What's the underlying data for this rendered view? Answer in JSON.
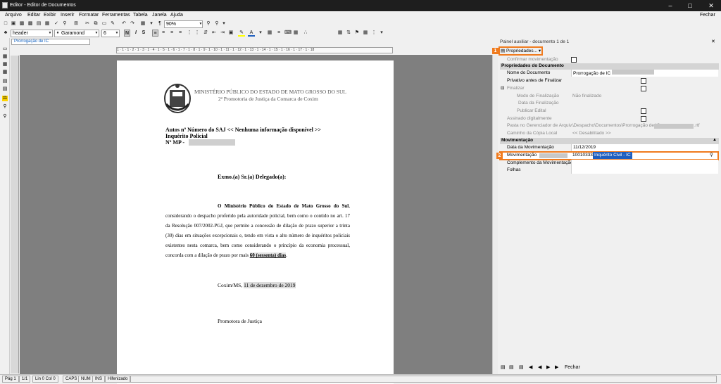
{
  "window": {
    "title": "Editor - Editor de Documentos",
    "close_label": "Fechar"
  },
  "menu": [
    "Arquivo",
    "Editar",
    "Exibir",
    "Inserir",
    "Formatar",
    "Ferramentas",
    "Tabela",
    "Janela",
    "Ajuda"
  ],
  "format_bar": {
    "style": "header",
    "font": "Garamond",
    "size": "6",
    "bold": "N",
    "italic": "I",
    "strike": "S",
    "zoom": "90%"
  },
  "style_box": "Prorrogação de IC",
  "ruler_text": "1 · 1 · 1 · 2 · 1 · 3 · 1 · 4 · 1 · 5 · 1 · 6 · 1 · 7 · 1 · 8 · 1 · 9 · 1 · 10 · 1 · 11 · 1 · 12 · 1 · 13 · 1 · 14 · 1 · 15 · 1 · 16 · 1 · 17 · 1 · 18",
  "document": {
    "header_line1": "MINISTÉRIO PÚBLICO DO ESTADO DE MATO GROSSO DO SUL",
    "header_line2": "2ª Promotoria de Justiça da Comarca de Coxim",
    "autos_line": "Autos nº Número do SAJ << Nenhuma informação disponível >>",
    "inquerito": "Inquérito Policial",
    "mp_label": "Nº MP -",
    "salutation": "Exmo.(a) Sr.(a) Delegado(a):",
    "body_intro": "O Ministério Público do Estado de Mato Grosso do Sul",
    "body_text": ", considerando o despacho proferido pela autoridade policial, bem como o contido no art. 17 da Resolução 007/2002-PGJ, que permite a concessão de dilação de prazo superior a trinta (30) dias em situações excepcionais e, tendo em vista o alto número de inquéritos policiais existentes nesta comarca, bem como considerando o princípio da economia processual, concorda com a dilação de prazo por mais ",
    "body_days": "60 (sessenta) dias",
    "body_end": ".",
    "place": "Coxim/MS,",
    "date": "11 de dezembro de 2019",
    "signature": "Promotora de Justiça"
  },
  "panel": {
    "title": "Painel auxiliar - documento 1 de 1",
    "properties_button": "Propriedades...",
    "confirm_move": "Confirmar movimentação",
    "section_doc": "Propriedades do Documento",
    "rows": [
      {
        "label": "Nome do Documento",
        "value": "Prorrogação de IC"
      },
      {
        "label": "Privativo antes de Finalizar",
        "value": ""
      },
      {
        "label": "Finalizar",
        "value": ""
      },
      {
        "label": "Modo de Finalização",
        "value": "Não finalizado"
      },
      {
        "label": "Data da Finalização",
        "value": ""
      },
      {
        "label": "Publicar Edital",
        "value": ""
      },
      {
        "label": "Assinado digitalmente",
        "value": ""
      },
      {
        "label": "Pasta no Gerenciador de Arquiv...",
        "value": "\\Despacho\\Documentos\\Prorrogação de IC",
        "value_suffix": ".rtf"
      },
      {
        "label": "Caminho da Cópia Local",
        "value": "<< Desabilitado >>"
      }
    ],
    "section_move": "Movimentação",
    "move_rows": [
      {
        "label": "Data da Movimentação",
        "value": "11/12/2019"
      },
      {
        "label": "Movimentação",
        "code": "10010333",
        "value": "Inquérito Civil - IC"
      },
      {
        "label": "Complemento da Movimentação",
        "value": ""
      },
      {
        "label": "Folhas",
        "value": ""
      }
    ],
    "footer_close": "Fechar",
    "badge1": "1",
    "badge2": "2"
  },
  "status": {
    "page": "Pág 1",
    "pages": "1/1",
    "pos": "Lin 0  Col 0",
    "caps": "CAPS",
    "num": "NUM",
    "ins": "INS",
    "hyphen": "Hifenizado"
  },
  "colors": {
    "accent": "#f07b1e",
    "selection": "#1f5fbf",
    "doc_bg": "#7f7f7f"
  }
}
